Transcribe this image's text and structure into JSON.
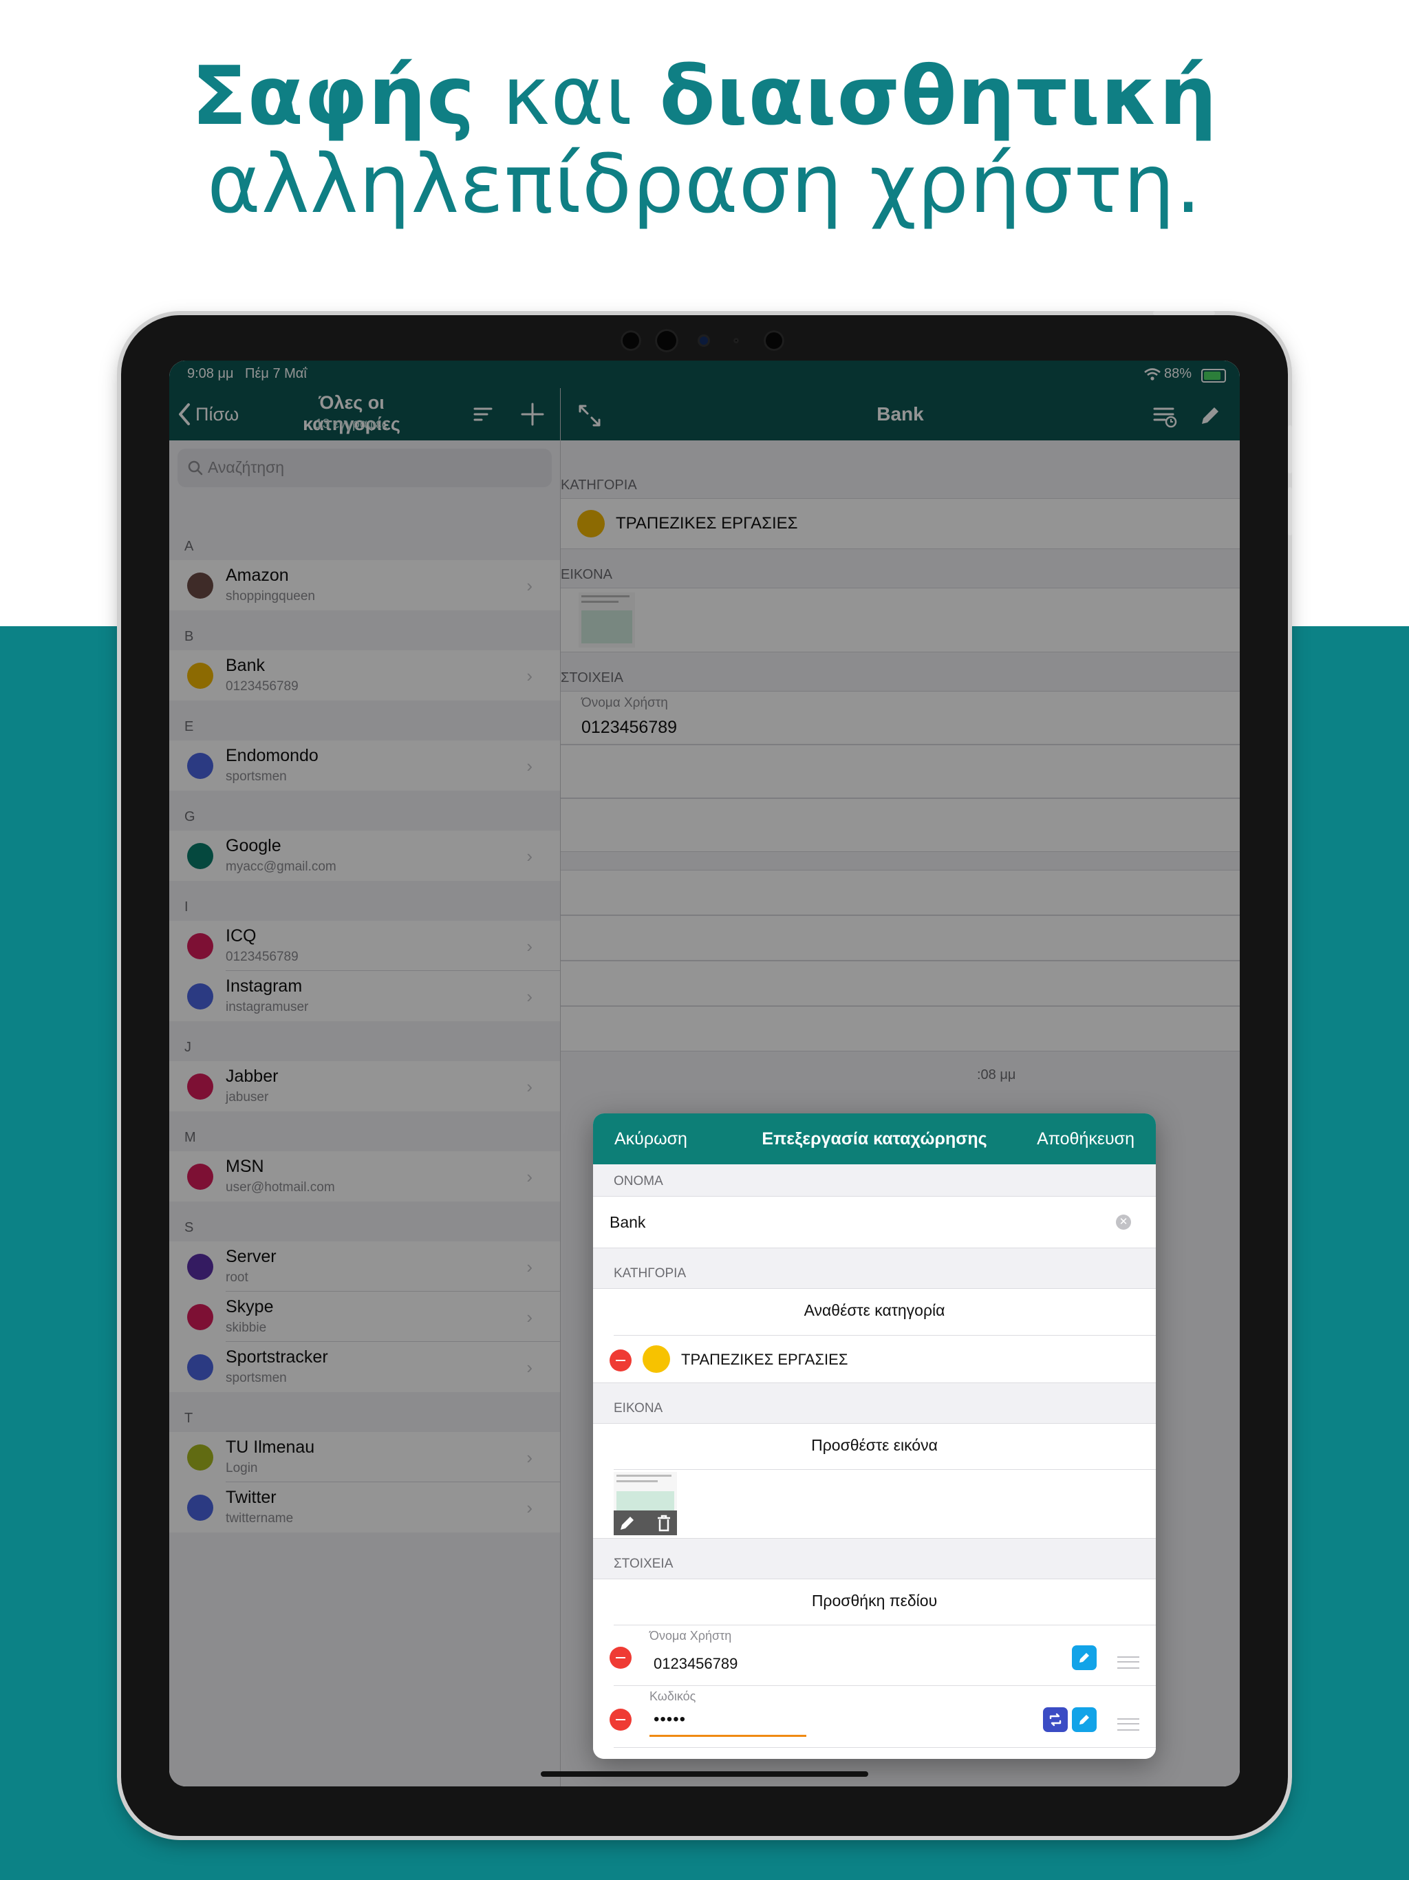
{
  "headline": {
    "line1_bold_a": "Σαφής",
    "line1_light": " και ",
    "line1_bold_b": "διαισθητική",
    "line2": "αλληλεπίδραση χρήστη."
  },
  "status_bar": {
    "time": "9:08 μμ",
    "date": "Πέμ 7 Μαΐ",
    "battery": "88%"
  },
  "left_nav": {
    "back_label": "Πίσω",
    "title": "Όλες οι κατηγορίες",
    "subtitle": "13 εγγραφές"
  },
  "search": {
    "placeholder": "Αναζήτηση"
  },
  "list": [
    {
      "letter": "A",
      "items": [
        {
          "title": "Amazon",
          "subtitle": "shoppingqueen",
          "color": "#6b4b45"
        }
      ]
    },
    {
      "letter": "B",
      "items": [
        {
          "title": "Bank",
          "subtitle": "0123456789",
          "color": "#f2b705"
        }
      ]
    },
    {
      "letter": "E",
      "items": [
        {
          "title": "Endomondo",
          "subtitle": "sportsmen",
          "color": "#4a64e0"
        }
      ]
    },
    {
      "letter": "G",
      "items": [
        {
          "title": "Google",
          "subtitle": "myacc@gmail.com",
          "color": "#0a7d6c"
        }
      ]
    },
    {
      "letter": "I",
      "items": [
        {
          "title": "ICQ",
          "subtitle": "0123456789",
          "color": "#d71c5a"
        },
        {
          "title": "Instagram",
          "subtitle": "instagramuser",
          "color": "#4a64e0"
        }
      ]
    },
    {
      "letter": "J",
      "items": [
        {
          "title": "Jabber",
          "subtitle": "jabuser",
          "color": "#d71c5a"
        }
      ]
    },
    {
      "letter": "M",
      "items": [
        {
          "title": "MSN",
          "subtitle": "user@hotmail.com",
          "color": "#d71c5a"
        }
      ]
    },
    {
      "letter": "S",
      "items": [
        {
          "title": "Server",
          "subtitle": "root",
          "color": "#5b2fa8"
        },
        {
          "title": "Skype",
          "subtitle": "skibbie",
          "color": "#d71c5a"
        },
        {
          "title": "Sportstracker",
          "subtitle": "sportsmen",
          "color": "#4a64e0"
        }
      ]
    },
    {
      "letter": "T",
      "items": [
        {
          "title": "TU Ilmenau",
          "subtitle": "Login",
          "color": "#a8b820"
        },
        {
          "title": "Twitter",
          "subtitle": "twittername",
          "color": "#4a64e0"
        }
      ]
    }
  ],
  "detail": {
    "title": "Bank",
    "category_header": "ΚΑΤΗΓΟΡΙΑ",
    "category_name": "ΤΡΑΠΕΖΙΚΕΣ ΕΡΓΑΣΙΕΣ",
    "category_color": "#f2b705",
    "image_header": "ΕΙΚΟΝΑ",
    "fields_header": "ΣΤΟΙΧΕΙΑ",
    "field1_label": "Όνομα Χρήστη",
    "field1_value": "0123456789",
    "partial_time": ":08 μμ"
  },
  "modal": {
    "cancel": "Ακύρωση",
    "title": "Επεξεργασία καταχώρησης",
    "save": "Αποθήκευση",
    "name_header": "ΟΝΟΜΑ",
    "name_value": "Bank",
    "category_header": "ΚΑΤΗΓΟΡΙΑ",
    "assign_category": "Αναθέστε κατηγορία",
    "category_name": "ΤΡΑΠΕΖΙΚΕΣ ΕΡΓΑΣΙΕΣ",
    "image_header": "ΕΙΚΟΝΑ",
    "add_image": "Προσθέστε εικόνα",
    "fields_header": "ΣΤΟΙΧΕΙΑ",
    "add_field": "Προσθήκη πεδίου",
    "field1_label": "Όνομα Χρήστη",
    "field1_value": "0123456789",
    "field2_label": "Κωδικός",
    "field2_value": "•••••"
  },
  "colors": {
    "teal_header": "#0d5552",
    "modal_header": "#0d7f77",
    "background_band": "#0c8286",
    "headline": "#0f7f84"
  }
}
